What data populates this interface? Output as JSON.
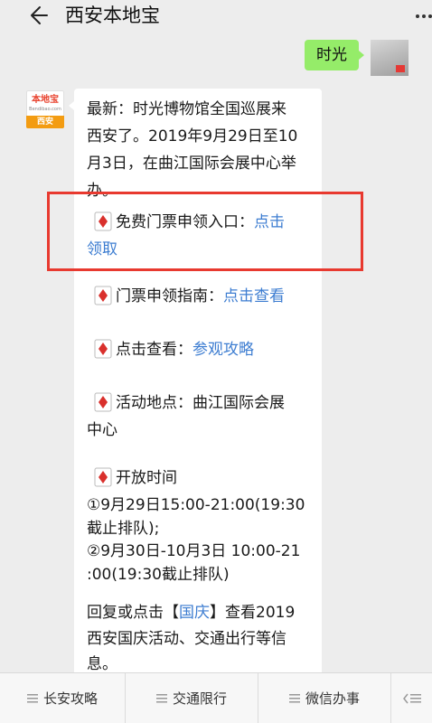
{
  "header": {
    "title": "西安本地宝"
  },
  "chat": {
    "my_message": "时光",
    "bot": {
      "avatar_brand": "本地宝",
      "avatar_site": "Bendibao.com",
      "avatar_city": "西安",
      "intro": [
        "最新：时光博物馆全国巡展来",
        "西安了。2019年9月29日至10",
        "月3日，在曲江国际会展中心举",
        "办。"
      ],
      "ticket_label": "免费门票申领入口：",
      "ticket_link_1": "点击",
      "ticket_link_2": "领取",
      "guide_label": "门票申领指南：",
      "guide_link": "点击查看",
      "view_label": "点击查看：",
      "view_link": "参观攻略",
      "location_1": "活动地点：曲江国际会展",
      "location_2": "中心",
      "hours_title": "开放时间",
      "hours": [
        "①9月29日15:00-21:00(19:30",
        "截止排队);",
        "②9月30日-10月3日 10:00-21",
        ":00(19:30截止排队)"
      ],
      "reply_pre": "回复或点击【",
      "reply_link": "国庆",
      "reply_post": "】查看2019",
      "reply_2": "西安国庆活动、交通出行等信",
      "reply_3": "息。"
    }
  },
  "bottom_menu": [
    {
      "label": "长安攻略"
    },
    {
      "label": "交通限行"
    },
    {
      "label": "微信办事"
    }
  ],
  "colors": {
    "accent_link": "#3d7dd1",
    "highlight": "#e8392f",
    "my_bubble": "#95ec69"
  }
}
